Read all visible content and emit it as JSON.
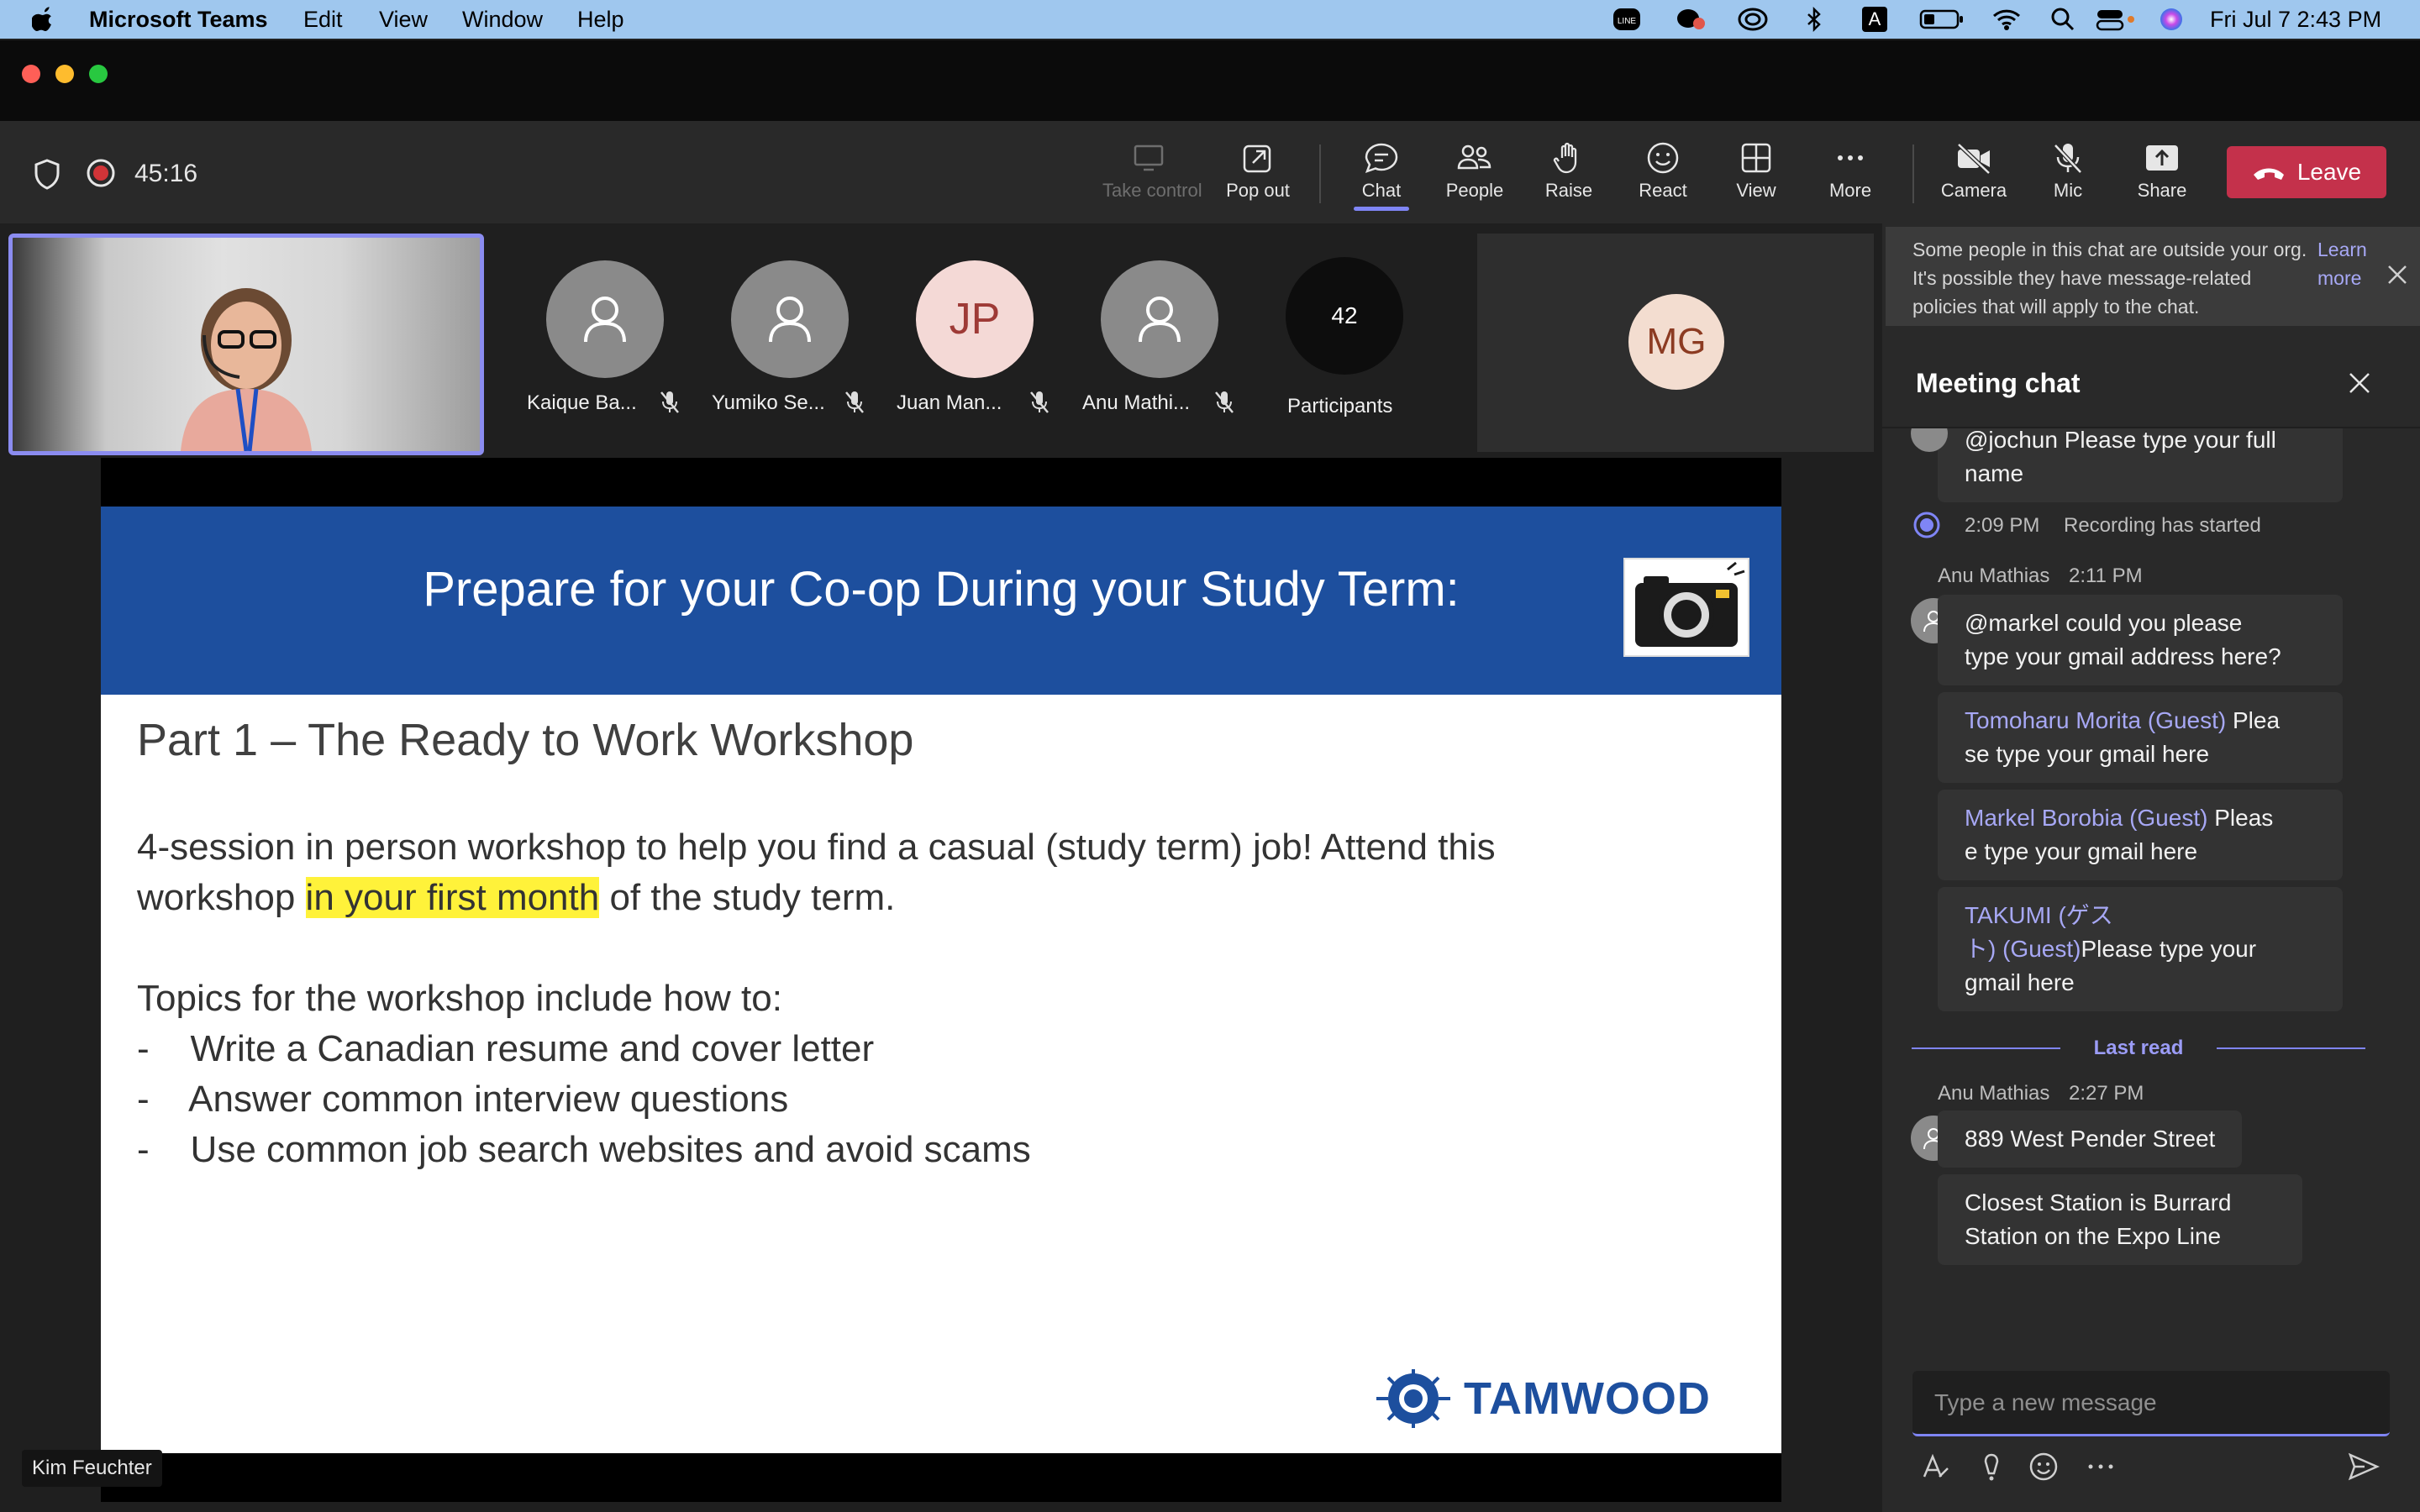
{
  "menubar": {
    "app_name": "Microsoft Teams",
    "menus": [
      "Edit",
      "View",
      "Window",
      "Help"
    ],
    "datetime": "Fri Jul 7  2:43 PM",
    "tray_letter": "A"
  },
  "toolbar": {
    "timer": "45:16",
    "buttons": {
      "take_control": "Take control",
      "pop_out": "Pop out",
      "chat": "Chat",
      "people": "People",
      "raise": "Raise",
      "react": "React",
      "view": "View",
      "more": "More",
      "camera": "Camera",
      "mic": "Mic",
      "share": "Share"
    },
    "leave_label": "Leave"
  },
  "participants": {
    "tiles": [
      {
        "name": "Kaique Ba...",
        "initials": ""
      },
      {
        "name": "Yumiko Se...",
        "initials": ""
      },
      {
        "name": "Juan Man...",
        "initials": "JP"
      },
      {
        "name": "Anu Mathi...",
        "initials": ""
      }
    ],
    "count": "42",
    "count_label": "Participants",
    "spotlight_initials": "MG",
    "presenter_name": "Kim Feuchter"
  },
  "slide": {
    "title": "Prepare for your Co-op During your Study Term:",
    "heading": "Part 1 – The Ready to Work Workshop",
    "line1": "4-session in person workshop to help you find a casual (study term) job!  Attend this",
    "line2_pre": "workshop ",
    "line2_highlight": "in your first month",
    "line2_post": " of the study term.",
    "topics_intro": "Topics for the workshop include how to:",
    "topics": [
      "-    Write a Canadian resume and cover letter",
      "-    Answer common interview questions",
      "-    Use common job search websites and avoid scams"
    ],
    "logo_text": "TAMWOOD"
  },
  "chat": {
    "notice_text": "Some people in this chat are outside your org. It's possible they have message-related policies that will apply to the chat.",
    "notice_link": "Learn more",
    "title": "Meeting chat",
    "partial_message_line1": "@jochun Please type your full",
    "partial_message_line2": "name",
    "recording_time": "2:09 PM",
    "recording_text": "Recording has started",
    "group1": {
      "sender": "Anu Mathias",
      "time": "2:11 PM",
      "message_line1": "@markel could you please",
      "message_line2": "type your gmail address here?",
      "mention1_name": "Tomoharu Morita (Guest)",
      "mention1_a": "Plea",
      "mention1_b": "se type your gmail here",
      "mention2_name": "Markel Borobia (Guest)",
      "mention2_a": "Pleas",
      "mention2_b": "e type your gmail here",
      "mention3_name_a": "TAKUMI (ゲス",
      "mention3_name_b": "ト) (Guest)",
      "mention3_a": "Please type your",
      "mention3_b": "gmail here"
    },
    "last_read": "Last read",
    "group2": {
      "sender": "Anu Mathias",
      "time": "2:27 PM",
      "message1": "889 West Pender Street",
      "message2_line1": "Closest Station is Burrard",
      "message2_line2": "Station on the Expo Line"
    },
    "composer_placeholder": "Type a new message"
  },
  "colors": {
    "accent": "#7f85f5",
    "leave": "#c4314b",
    "slide_band": "#1d4f9e",
    "highlight": "#fff23a"
  }
}
